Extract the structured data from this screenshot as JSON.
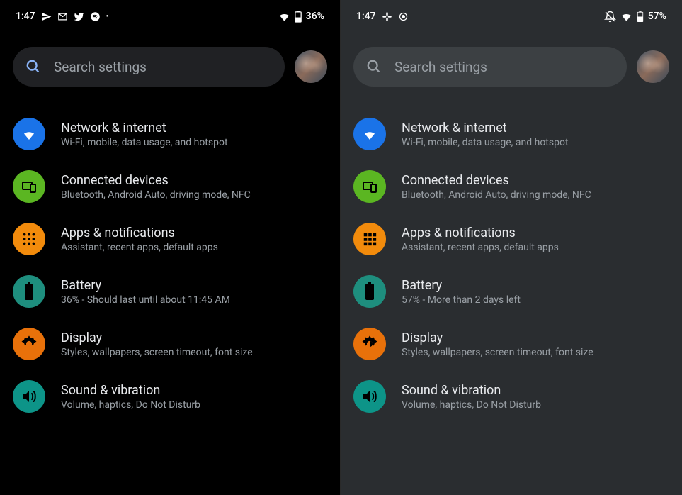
{
  "left": {
    "status": {
      "time": "1:47",
      "battery": "36%"
    },
    "search": {
      "placeholder": "Search settings"
    },
    "items": [
      {
        "title": "Network & internet",
        "sub": "Wi-Fi, mobile, data usage, and hotspot"
      },
      {
        "title": "Connected devices",
        "sub": "Bluetooth, Android Auto, driving mode, NFC"
      },
      {
        "title": "Apps & notifications",
        "sub": "Assistant, recent apps, default apps"
      },
      {
        "title": "Battery",
        "sub": "36% - Should last until about 11:45 AM"
      },
      {
        "title": "Display",
        "sub": "Styles, wallpapers, screen timeout, font size"
      },
      {
        "title": "Sound & vibration",
        "sub": "Volume, haptics, Do Not Disturb"
      }
    ]
  },
  "right": {
    "status": {
      "time": "1:47",
      "battery": "57%"
    },
    "search": {
      "placeholder": "Search settings"
    },
    "items": [
      {
        "title": "Network & internet",
        "sub": "Wi-Fi, mobile, data usage, and hotspot"
      },
      {
        "title": "Connected devices",
        "sub": "Bluetooth, Android Auto, driving mode, NFC"
      },
      {
        "title": "Apps & notifications",
        "sub": "Assistant, recent apps, default apps"
      },
      {
        "title": "Battery",
        "sub": "57% - More than 2 days left"
      },
      {
        "title": "Display",
        "sub": "Styles, wallpapers, screen timeout, font size"
      },
      {
        "title": "Sound & vibration",
        "sub": "Volume, haptics, Do Not Disturb"
      }
    ]
  }
}
